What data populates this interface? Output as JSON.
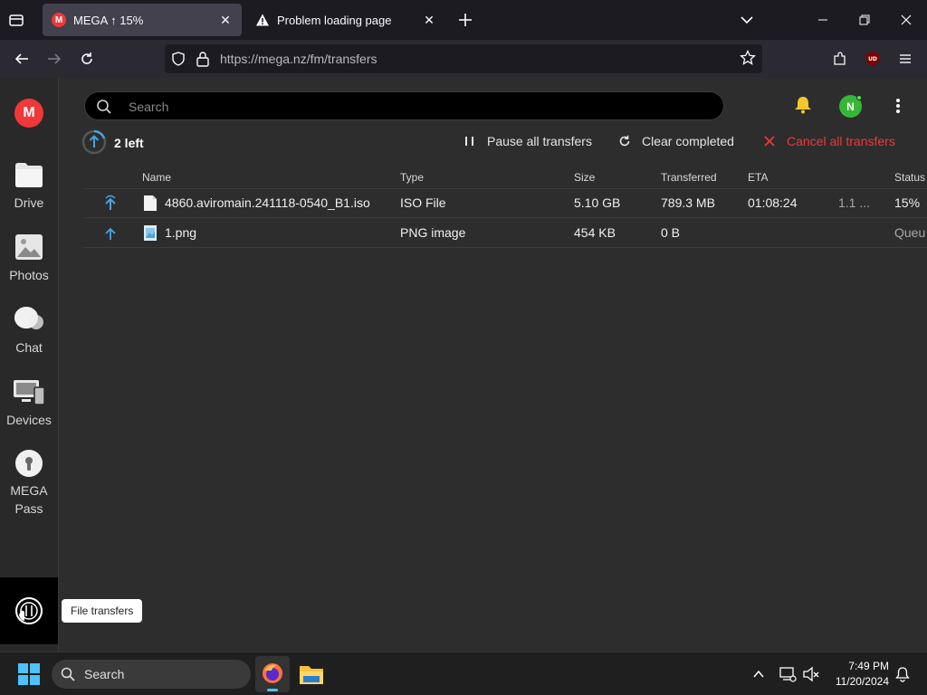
{
  "browser": {
    "tabs": [
      {
        "title": "MEGA ↑ 15%",
        "active": true
      },
      {
        "title": "Problem loading page",
        "active": false
      }
    ],
    "url": "https://mega.nz/fm/transfers"
  },
  "sidebar": {
    "logo": "M",
    "items": [
      {
        "label": "Drive",
        "icon": "folder-icon"
      },
      {
        "label": "Photos",
        "icon": "photos-icon"
      },
      {
        "label": "Chat",
        "icon": "chat-icon"
      },
      {
        "label": "Devices",
        "icon": "devices-icon"
      },
      {
        "label": "MEGA",
        "label2": "Pass",
        "icon": "pass-icon"
      }
    ],
    "tooltip": "File transfers"
  },
  "header": {
    "search_placeholder": "Search",
    "avatar_initial": "N"
  },
  "toolbar": {
    "left_count": "2 left",
    "pause_all": "Pause all transfers",
    "clear_completed": "Clear completed",
    "cancel_all": "Cancel all transfers"
  },
  "table": {
    "headers": {
      "name": "Name",
      "type": "Type",
      "size": "Size",
      "transferred": "Transferred",
      "eta": "ETA",
      "status": "Status"
    },
    "rows": [
      {
        "name": "4860.aviromain.241118-0540_B1.iso",
        "type": "ISO File",
        "size": "5.10 GB",
        "transferred": "789.3 MB",
        "eta": "01:08:24",
        "speed": "1.1 ...",
        "status": "15%"
      },
      {
        "name": "1.png",
        "type": "PNG image",
        "size": "454 KB",
        "transferred": "0 B",
        "eta": "",
        "speed": "",
        "status": "Queu"
      }
    ]
  },
  "taskbar": {
    "search_label": "Search",
    "time": "7:49 PM",
    "date": "11/20/2024"
  },
  "colors": {
    "mega_red": "#f0373a",
    "upload_blue": "#4aa3df",
    "avatar_green": "#36b636"
  }
}
